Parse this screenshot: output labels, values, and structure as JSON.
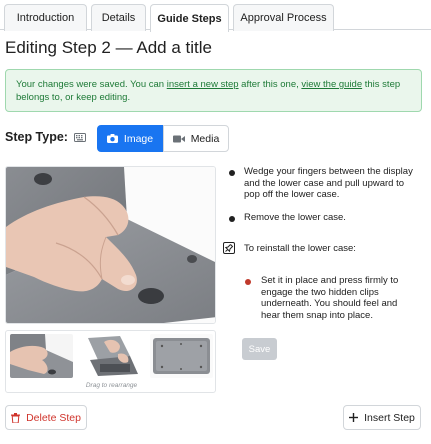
{
  "tabs": [
    {
      "label": "Introduction",
      "active": false
    },
    {
      "label": "Details",
      "active": false
    },
    {
      "label": "Guide Steps",
      "active": true
    },
    {
      "label": "Approval Process",
      "active": false
    }
  ],
  "page_title": "Editing Step 2 — Add a title",
  "alert": {
    "text_1": "Your changes were saved. You can ",
    "link_insert": "insert a new step",
    "text_2": " after this one, ",
    "link_guide": "view the guide",
    "text_3": " this step belongs to, or keep editing."
  },
  "step_type": {
    "label": "Step Type:",
    "options": [
      {
        "label": "Image",
        "icon": "camera-icon",
        "selected": true
      },
      {
        "label": "Media",
        "icon": "video-icon",
        "selected": false
      }
    ]
  },
  "images": {
    "drag_hint": "Drag to rearrange"
  },
  "bullets": [
    {
      "color": "black",
      "text": "Wedge your fingers between the display and the lower case and pull upward to pop off the lower case."
    },
    {
      "color": "black",
      "text": "Remove the lower case."
    },
    {
      "color": "note",
      "text": "To reinstall the lower case:"
    },
    {
      "color": "red",
      "text": "Set it in place and press firmly to engage the two hidden clips underneath. You should feel and hear them snap into place."
    }
  ],
  "actions": {
    "save": "Save",
    "delete_step": "Delete Step",
    "insert_step": "Insert Step"
  },
  "colors": {
    "primary": "#1975f1",
    "success_bg": "#eaf6ec",
    "success_text": "#1e7a37",
    "danger": "#d0342c",
    "bullet_red": "#c0392b"
  }
}
